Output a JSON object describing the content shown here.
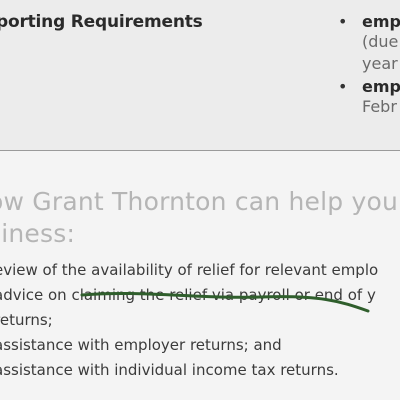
{
  "header": {
    "heading": "porting Requirements"
  },
  "right_column": {
    "items": [
      {
        "bold": "emp",
        "lines": [
          "(due",
          "year"
        ]
      },
      {
        "bold": "emp",
        "lines": [
          "Febr"
        ]
      }
    ]
  },
  "section": {
    "title": "ow Grant Thornton can help your siness:",
    "items": [
      "eview of the availability of relief for relevant emplo",
      "advice on claiming the relief via payroll or end of y",
      "returns;",
      "assistance with employer returns; and",
      "assistance with individual income tax returns."
    ]
  },
  "colors": {
    "strike_mark": "#2f5e2c",
    "title_grey": "#b5b5b5"
  }
}
